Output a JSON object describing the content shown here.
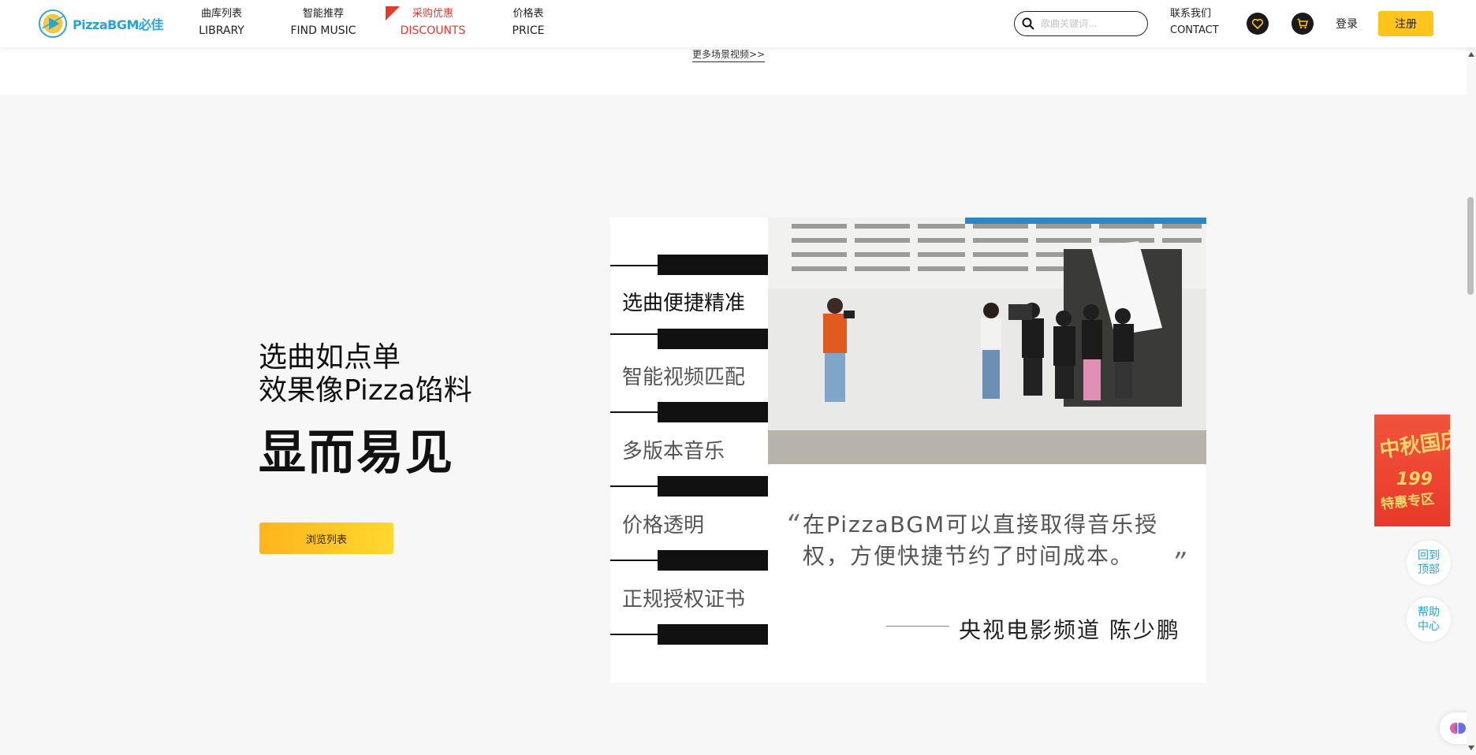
{
  "header": {
    "logo_text": "PizzaBGM必佳",
    "nav": [
      {
        "zh": "曲库列表",
        "en": "LIBRARY"
      },
      {
        "zh": "智能推荐",
        "en": "FIND MUSIC"
      },
      {
        "zh": "采购优惠",
        "en": "DISCOUNTS"
      },
      {
        "zh": "价格表",
        "en": "PRICE"
      }
    ],
    "search_placeholder": "歌曲关键词...",
    "contact_zh": "联系我们",
    "contact_en": "CONTACT",
    "login": "登录",
    "register": "注册"
  },
  "colors": {
    "accent": "#ffc51a",
    "discount": "#e23b2e",
    "brand_blue": "#2aa4d3"
  },
  "more_videos": "更多场景视频>>",
  "hero": {
    "line1": "选曲如点单",
    "line2": "效果像Pizza馅料",
    "line3": "显而易见",
    "browse_button": "浏览列表"
  },
  "features": [
    {
      "label": "选曲便捷精准",
      "active": true
    },
    {
      "label": "智能视频匹配",
      "active": false
    },
    {
      "label": "多版本音乐",
      "active": false
    },
    {
      "label": "价格透明",
      "active": false
    },
    {
      "label": "正规授权证书",
      "active": false
    }
  ],
  "testimonial": {
    "quote": "在PizzaBGM可以直接取得音乐授权，方便快捷节约了时间成本。",
    "author": "央视电影频道  陈少鹏"
  },
  "promo": {
    "headline": "中秋国庆",
    "price": "199",
    "tag": "特惠专区"
  },
  "floating": {
    "back_to_top": "回到\n顶部",
    "help_center": "帮助\n中心"
  }
}
